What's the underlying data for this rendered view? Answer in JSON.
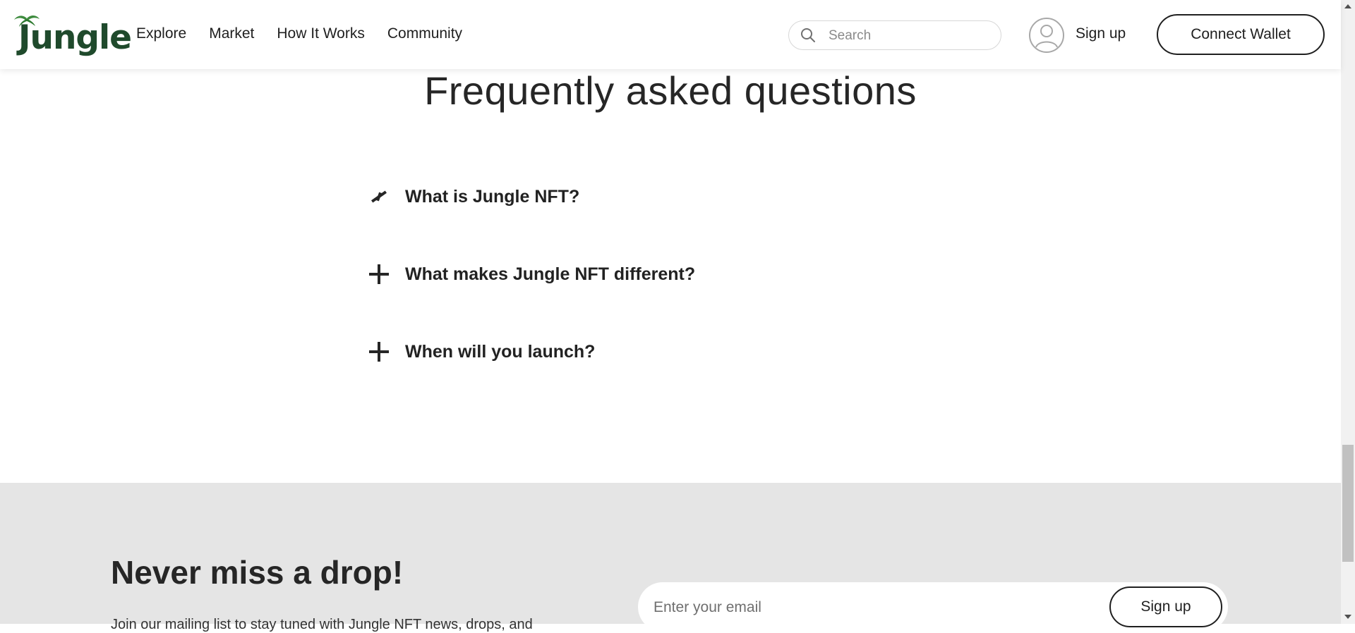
{
  "brand": {
    "logo_text": "Jungle",
    "logo_color": "#1f4a2c",
    "palm_color": "#3d8b3d"
  },
  "nav": {
    "items": [
      "Explore",
      "Market",
      "How It Works",
      "Community"
    ]
  },
  "search": {
    "placeholder": "Search",
    "icon": "search-icon"
  },
  "account": {
    "avatar_icon": "user-avatar-icon",
    "signup_label": "Sign up"
  },
  "wallet": {
    "label": "Connect Wallet"
  },
  "faq": {
    "title": "Frequently asked questions",
    "items": [
      {
        "question": "What is Jungle NFT?",
        "icon": "spinning-plus-icon"
      },
      {
        "question": "What makes Jungle NFT different?",
        "icon": "plus-icon"
      },
      {
        "question": "When will you launch?",
        "icon": "plus-icon"
      }
    ]
  },
  "newsletter": {
    "heading": "Never miss a drop!",
    "text": "Join our mailing list to stay tuned with Jungle NFT news, drops, and",
    "email_placeholder": "Enter your email",
    "button_label": "Sign up",
    "background": "#e5e5e5"
  }
}
